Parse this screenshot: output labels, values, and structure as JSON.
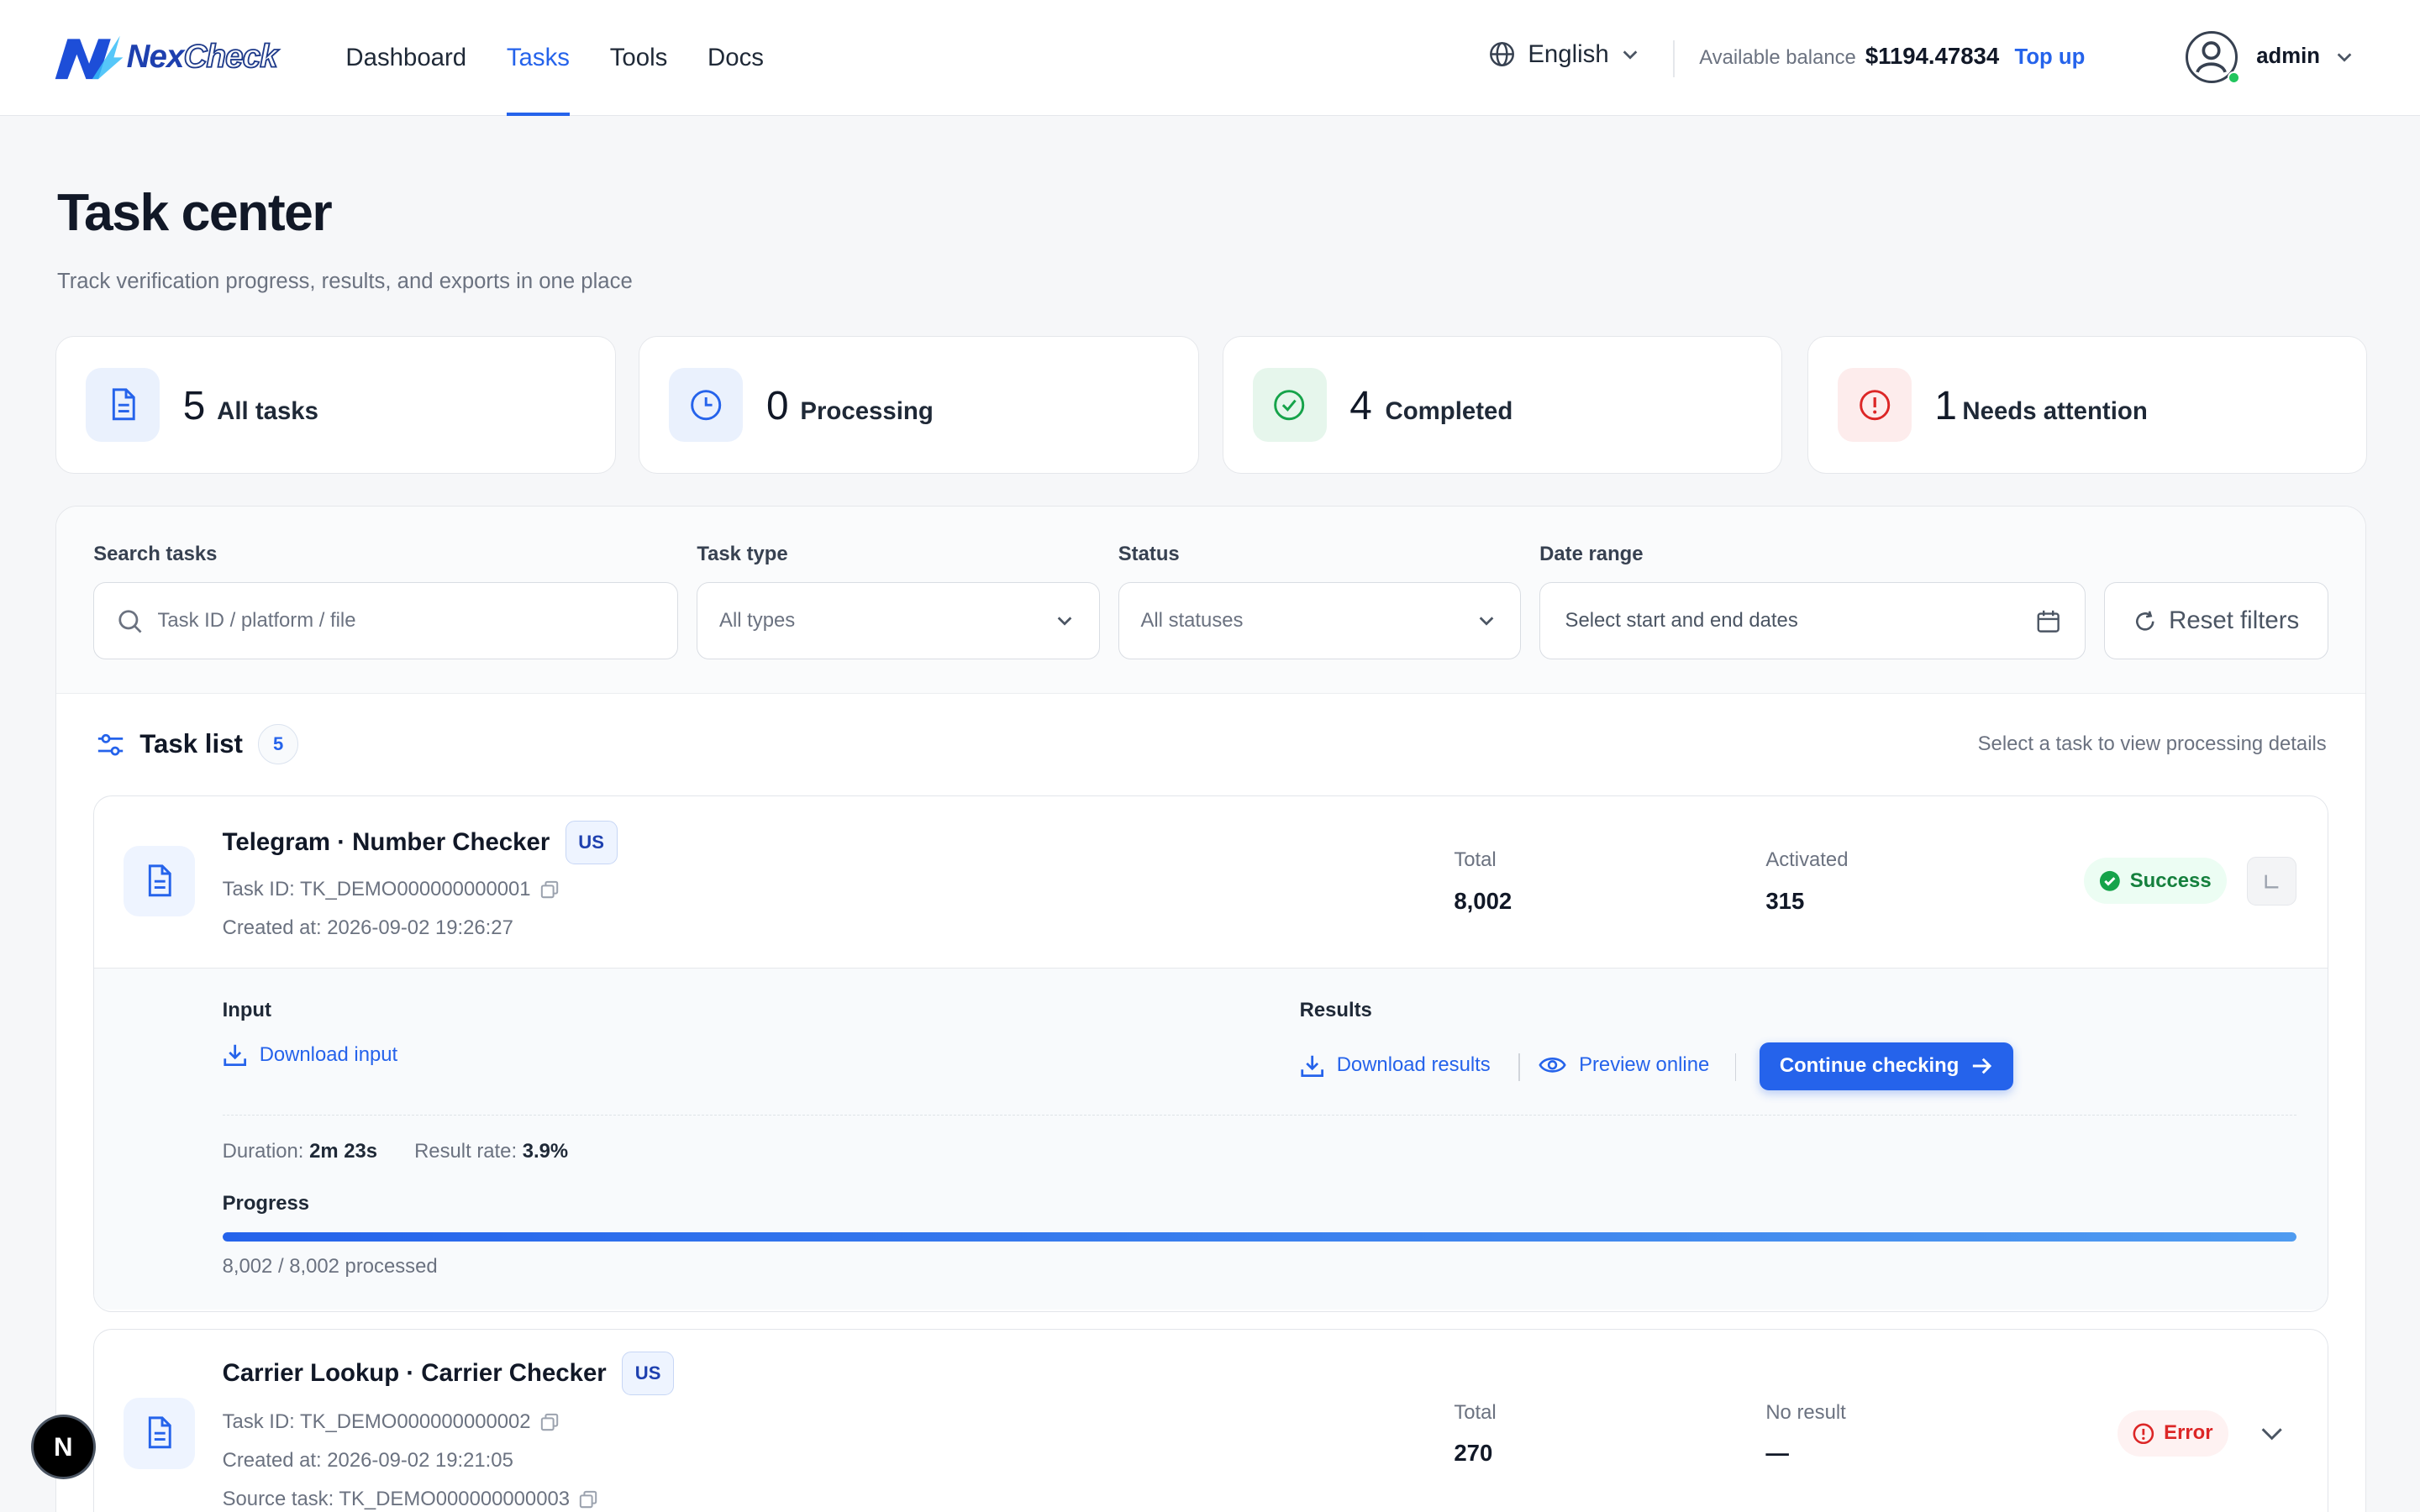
{
  "header": {
    "brand_a": "Nex",
    "brand_b": "Check",
    "nav": [
      "Dashboard",
      "Tasks",
      "Tools",
      "Docs"
    ],
    "active_nav": "Tasks",
    "language": "English",
    "balance_label": "Available balance",
    "balance": "$1194.47834",
    "topup": "Top up",
    "username": "admin"
  },
  "page": {
    "title": "Task center",
    "subtitle": "Track verification progress, results, and exports in one place"
  },
  "stats": [
    {
      "count": "5",
      "label": "All tasks",
      "icon": "document-icon"
    },
    {
      "count": "0",
      "label": "Processing",
      "icon": "clock-icon"
    },
    {
      "count": "4",
      "label": "Completed",
      "icon": "check-circle-icon"
    },
    {
      "count": "1",
      "label": "Needs attention",
      "icon": "alert-circle-icon"
    }
  ],
  "filters": {
    "search_label": "Search tasks",
    "search_placeholder": "Task ID / platform / file",
    "type_label": "Task type",
    "type_value": "All types",
    "status_label": "Status",
    "status_value": "All statuses",
    "date_label": "Date range",
    "date_placeholder": "Select start and end dates",
    "reset": "Reset filters"
  },
  "task_list": {
    "title": "Task list",
    "count": "5",
    "hint": "Select a task to view processing details"
  },
  "tasks": [
    {
      "name": "Telegram · Number Checker",
      "country": "US",
      "task_id": "Task ID: TK_DEMO000000000001",
      "created": "Created at: 2026-09-02 19:26:27",
      "total_label": "Total",
      "total": "8,002",
      "second_label": "Activated",
      "second": "315",
      "status": "Success",
      "expanded": {
        "input_label": "Input",
        "download_input": "Download input",
        "results_label": "Results",
        "download_results": "Download results",
        "preview_online": "Preview online",
        "continue": "Continue checking",
        "duration_label": "Duration:",
        "duration": "2m 23s",
        "rate_label": "Result rate:",
        "rate": "3.9%",
        "progress_label": "Progress",
        "progress": 1.0,
        "progress_text": "8,002 / 8,002 processed"
      }
    },
    {
      "name": "Carrier Lookup · Carrier Checker",
      "country": "US",
      "task_id": "Task ID: TK_DEMO000000000002",
      "created": "Created at: 2026-09-02 19:21:05",
      "source": "Source task: TK_DEMO000000000003",
      "total_label": "Total",
      "total": "270",
      "second_label": "No result",
      "second": "—",
      "status": "Error"
    }
  ],
  "colors": {
    "accent": "#2563eb",
    "success": "#15803d",
    "error": "#dc2626"
  },
  "fab": "N"
}
